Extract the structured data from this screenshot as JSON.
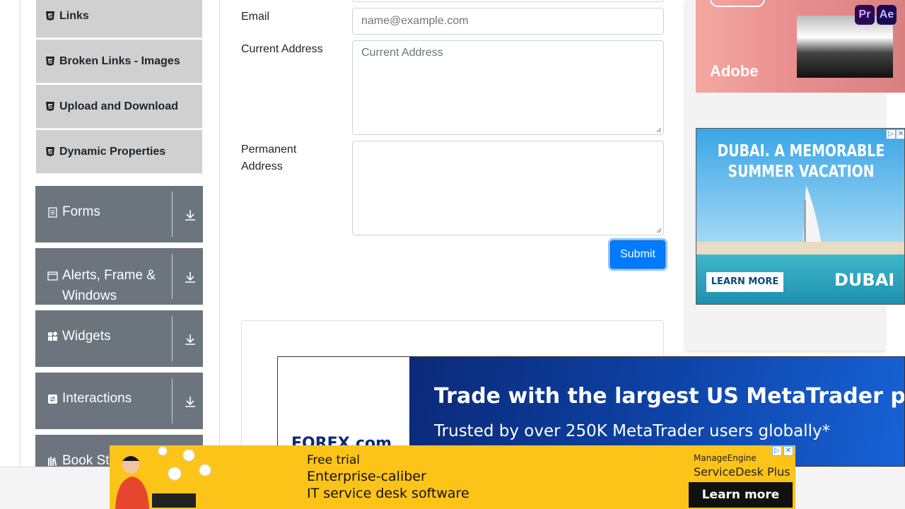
{
  "sidebar": {
    "elements_items": [
      {
        "label": "Links"
      },
      {
        "label": "Broken Links - Images"
      },
      {
        "label": "Upload and Download"
      },
      {
        "label": "Dynamic Properties"
      }
    ],
    "groups": [
      {
        "label": "Forms",
        "icon": "form-icon"
      },
      {
        "label": "Alerts, Frame & Windows",
        "icon": "window-icon"
      },
      {
        "label": "Widgets",
        "icon": "widgets-icon"
      },
      {
        "label": "Interactions",
        "icon": "interactions-icon"
      },
      {
        "label": "Book Store Application",
        "icon": "book-icon"
      }
    ]
  },
  "form": {
    "email_label": "Email",
    "email_placeholder": "name@example.com",
    "current_address_label": "Current Address",
    "current_address_placeholder": "Current Address",
    "permanent_address_label": "Permanent Address",
    "submit_label": "Submit"
  },
  "ads": {
    "adobe": {
      "brand": "Adobe",
      "badge1": "Pr",
      "badge2": "Ae"
    },
    "dubai": {
      "headline_line1": "DUBAI. A MEMORABLE",
      "headline_line2": "SUMMER VACATION",
      "cta": "LEARN MORE",
      "logo": "DUBAI"
    },
    "forex": {
      "title": "Trade with the largest US MetaTrader provider",
      "subtitle": "Trusted by over 250K MetaTrader users globally*",
      "logo": "FOREX.com"
    },
    "servicedesk": {
      "line1": "Free trial",
      "line2": "Enterprise-caliber",
      "line3": "IT service desk software",
      "brand_line1": "ManageEngine",
      "brand_line2": "ServiceDesk Plus",
      "cta": "Learn more"
    }
  },
  "colors": {
    "sidebar_group": "#6c757d",
    "sub_item": "#d0d0d0",
    "primary": "#007bff",
    "ad_yellow": "#fcc419"
  }
}
